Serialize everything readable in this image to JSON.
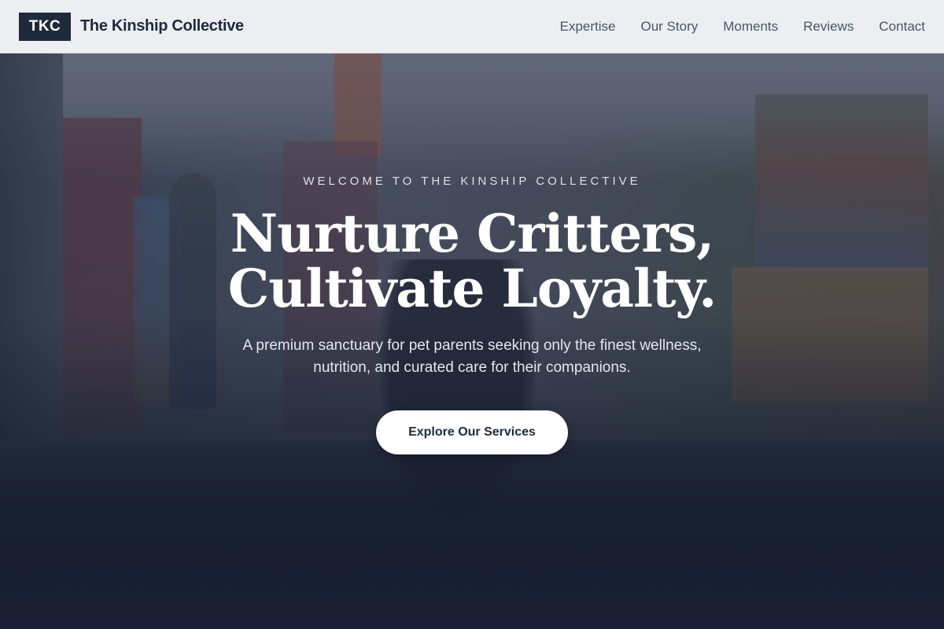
{
  "navbar": {
    "logo_text": "TKC",
    "brand_name": "The Kinship Collective",
    "links": [
      {
        "label": "Expertise"
      },
      {
        "label": "Our Story"
      },
      {
        "label": "Moments"
      },
      {
        "label": "Reviews"
      },
      {
        "label": "Contact"
      }
    ]
  },
  "hero": {
    "eyebrow": "WELCOME TO THE KINSHIP COLLECTIVE",
    "headline_line1": "Nurture Critters,",
    "headline_line2": "Cultivate Loyalty.",
    "subtitle_line1": "A premium sanctuary for pet parents seeking only the finest wellness,",
    "subtitle_line2": "nutrition, and curated care for their companions.",
    "cta_label": "Explore Our Services"
  },
  "colors": {
    "brand_dark": "#1e293b",
    "nav_background": "#f3f4f6",
    "nav_link": "#475569",
    "hero_overlay": "#1a2033",
    "cta_background": "#ffffff"
  }
}
